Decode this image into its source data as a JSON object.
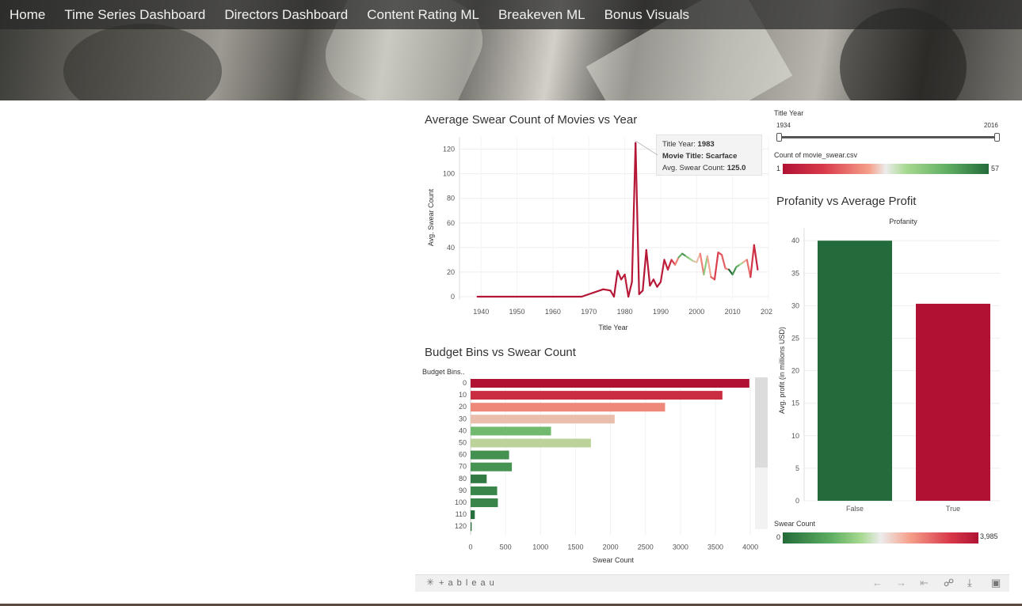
{
  "nav": [
    "Home",
    "Time Series Dashboard",
    "Directors Dashboard",
    "Content Rating ML",
    "Breakeven ML",
    "Bonus Visuals"
  ],
  "line_chart": {
    "title": "Average Swear Count of Movies vs Year",
    "ylabel": "Avg. Swear Count",
    "xlabel": "Title Year",
    "yticks": [
      "0",
      "20",
      "40",
      "60",
      "80",
      "100",
      "120"
    ],
    "xticks": [
      "1940",
      "1950",
      "1960",
      "1970",
      "1980",
      "1990",
      "2000",
      "2010",
      "2020"
    ]
  },
  "tooltip": {
    "year_label": "Title Year:",
    "year_value": "1983",
    "movie_label": "Movie Title:",
    "movie_value": "Scarface",
    "avg_label": "Avg. Swear Count:",
    "avg_value": "125.0"
  },
  "filter": {
    "label": "Title Year",
    "min": "1934",
    "max": "2016",
    "count_label": "Count of movie_swear.csv",
    "count_min": "1",
    "count_max": "57"
  },
  "bar_chart": {
    "title": "Budget Bins vs Swear Count",
    "header": "Budget Bins..",
    "xlabel": "Swear Count",
    "xticks": [
      "0",
      "500",
      "1000",
      "1500",
      "2000",
      "2500",
      "3000",
      "3500",
      "4000"
    ]
  },
  "profit_chart": {
    "title": "Profanity vs Average Profit",
    "header": "Profanity",
    "ylabel": "Avg. profit (in millions USD)",
    "yticks": [
      "0",
      "5",
      "10",
      "15",
      "20",
      "25",
      "30",
      "35",
      "40"
    ]
  },
  "swear_legend": {
    "label": "Swear Count",
    "min": "0",
    "max": "3,985"
  },
  "tableau_logo": "+ a b l e a u",
  "colors": {
    "red": "#b01234",
    "dark_green": "#236b3a",
    "light_green": "#8fd07f",
    "salmon": "#e9a489"
  },
  "chart_data": [
    {
      "type": "line",
      "title": "Average Swear Count of Movies vs Year",
      "xlabel": "Title Year",
      "ylabel": "Avg. Swear Count",
      "xlim": [
        1934,
        2020
      ],
      "ylim": [
        0,
        130
      ],
      "x": [
        1939,
        1945,
        1955,
        1960,
        1968,
        1974,
        1976,
        1977,
        1978,
        1979,
        1980,
        1981,
        1982,
        1983,
        1984,
        1985,
        1986,
        1987,
        1988,
        1989,
        1990,
        1991,
        1992,
        1993,
        1994,
        1995,
        1996,
        1997,
        1998,
        1999,
        2000,
        2001,
        2002,
        2003,
        2004,
        2005,
        2006,
        2007,
        2008,
        2009,
        2010,
        2011,
        2012,
        2013,
        2014,
        2015,
        2016,
        2017
      ],
      "y": [
        0,
        0,
        0,
        0,
        0,
        6,
        5,
        0,
        21,
        14,
        18,
        0,
        12,
        125,
        2,
        5,
        38,
        9,
        14,
        8,
        12,
        30,
        22,
        30,
        26,
        32,
        35,
        33,
        31,
        29,
        28,
        35,
        18,
        33,
        16,
        14,
        36,
        34,
        23,
        22,
        18,
        24,
        26,
        28,
        30,
        16,
        42,
        22
      ],
      "colorvals": [
        1,
        1,
        1,
        1,
        1,
        2,
        2,
        1,
        3,
        2,
        3,
        1,
        2,
        1,
        1,
        1,
        2,
        2,
        2,
        2,
        3,
        4,
        6,
        12,
        20,
        45,
        50,
        40,
        35,
        30,
        28,
        20,
        38,
        25,
        16,
        12,
        14,
        16,
        20,
        57,
        50,
        45,
        35,
        25,
        18,
        10,
        6,
        4
      ]
    },
    {
      "type": "bar",
      "title": "Budget Bins vs Swear Count",
      "xlabel": "Swear Count",
      "categories": [
        "0",
        "10",
        "20",
        "30",
        "40",
        "50",
        "60",
        "70",
        "80",
        "90",
        "100",
        "110",
        "120"
      ],
      "values": [
        3985,
        3600,
        2780,
        2060,
        1150,
        1720,
        550,
        590,
        230,
        380,
        390,
        60,
        15
      ],
      "xlim": [
        0,
        4100
      ]
    },
    {
      "type": "bar",
      "title": "Profanity vs Average Profit",
      "ylabel": "Avg. profit (in millions USD)",
      "categories": [
        "False",
        "True"
      ],
      "values": [
        40.0,
        30.3
      ],
      "ylim": [
        0,
        41
      ]
    }
  ]
}
